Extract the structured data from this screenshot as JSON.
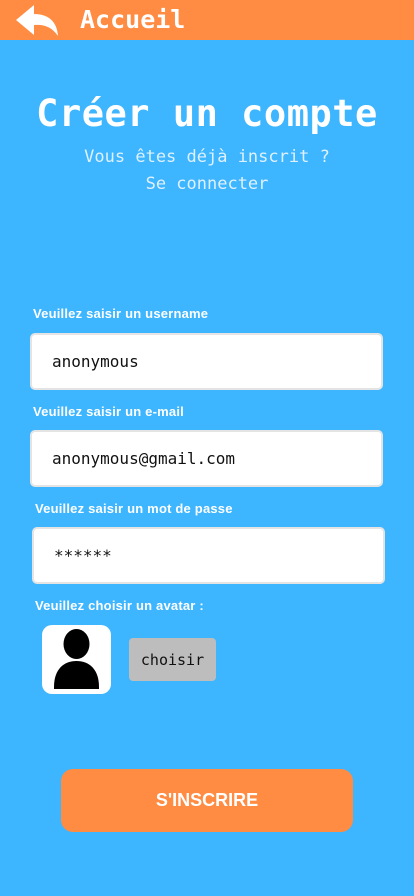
{
  "header": {
    "title": "Accueil",
    "back_icon": "back-arrow-icon"
  },
  "page": {
    "title": "Créer un compte",
    "login_prompt_line1": "Vous êtes déjà inscrit ?",
    "login_prompt_line2": "Se connecter"
  },
  "form": {
    "username_label": "Veuillez saisir un username",
    "username_value": "anonymous",
    "email_label": "Veuillez saisir un e-mail",
    "email_value": "anonymous@gmail.com",
    "password_label": "Veuillez saisir un mot de passe",
    "password_value": "******",
    "avatar_label": "Veuillez choisir un avatar :",
    "avatar_icon": "user-silhouette-icon",
    "choose_label": "choisir",
    "submit_label": "S'INSCRIRE"
  },
  "colors": {
    "background": "#3db5ff",
    "accent": "#ff8c42",
    "button_grey": "#bdbdbd"
  }
}
